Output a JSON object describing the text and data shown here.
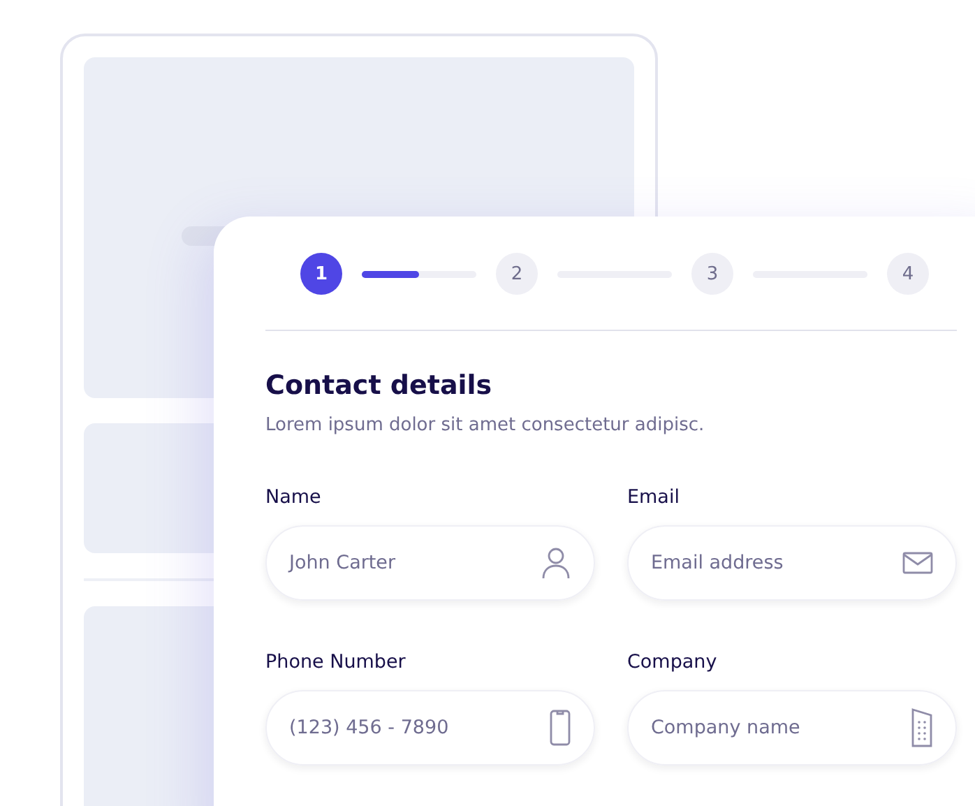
{
  "steps": [
    {
      "label": "1",
      "selected": true
    },
    {
      "label": "2",
      "selected": false
    },
    {
      "label": "3",
      "selected": false
    },
    {
      "label": "4",
      "selected": false
    }
  ],
  "step_progress": {
    "level": 0.5
  },
  "title": "Contact details",
  "description": "Lorem ipsum dolor sit amet consectetur adipisc.",
  "fields": [
    {
      "label": "Name",
      "placeholder": "John Carter",
      "kind": "person"
    },
    {
      "label": "Email",
      "placeholder": "Email address",
      "kind": "email"
    },
    {
      "label": "Phone Number",
      "placeholder": "(123) 456 - 7890",
      "kind": "phone"
    },
    {
      "label": "Company",
      "placeholder": "Company name",
      "kind": "company"
    }
  ]
}
